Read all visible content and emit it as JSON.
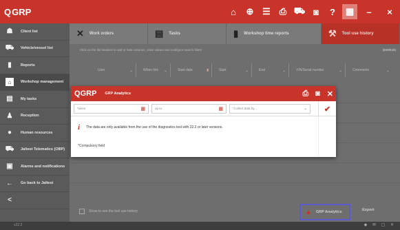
{
  "app": {
    "logo": "GRP",
    "logo_q": "Q"
  },
  "topbar": {
    "icons": [
      "home-icon",
      "globe-icon",
      "list-icon",
      "print-icon",
      "car-icon",
      "camera-icon",
      "help-icon",
      "grid-icon",
      "minimize-icon",
      "close-icon"
    ],
    "help_label": "?",
    "minimize_label": "–",
    "close_label": "×"
  },
  "sidebar": {
    "items": [
      {
        "label": "Client list",
        "icon": "user-icon"
      },
      {
        "label": "Vehicle/vessel list",
        "icon": "vehicle-icon"
      },
      {
        "label": "Reports",
        "icon": "report-icon"
      },
      {
        "label": "Workshop management",
        "icon": "workshop-icon"
      },
      {
        "label": "My tasks",
        "icon": "tasks-icon"
      },
      {
        "label": "Reception",
        "icon": "reception-icon"
      },
      {
        "label": "Human resources",
        "icon": "hr-icon"
      },
      {
        "label": "Jaltest Telematics (OBP)",
        "icon": "telematics-icon"
      },
      {
        "label": "Alarms and notifications",
        "icon": "alarm-icon"
      },
      {
        "label": "Go back to Jaltest",
        "icon": "back-arrow-icon"
      }
    ],
    "collapse_label": "<"
  },
  "tabs": [
    {
      "label": "Work orders"
    },
    {
      "label": "Tasks"
    },
    {
      "label": "Workshop time reports"
    },
    {
      "label": "Tool use history"
    }
  ],
  "main": {
    "hint": "Click on the list headers to add or hide columns, order values and configure search filters",
    "count": "(849/849)",
    "filters": [
      "User",
      "When link",
      "Start date",
      "Start",
      "End",
      "VIN/Serial number",
      "Comments"
    ],
    "show_old_label": "Show to see the tool use history",
    "grp_button": "GRP Analytics",
    "export_button": "Export"
  },
  "status": {
    "left": "v22.2",
    "right": "◆ ✉ ▢ ✕"
  },
  "dialog": {
    "logo": "GRP",
    "title": "GRP Analytics",
    "since_placeholder": "*since",
    "upto_placeholder": "up to",
    "collect_placeholder": "*Collect data by...",
    "info_text": "The data are only available from the use of the diagnostics tool with 22.2 or later versions.",
    "compulsory": "*Compulsory field",
    "accent": "#c8342a"
  }
}
